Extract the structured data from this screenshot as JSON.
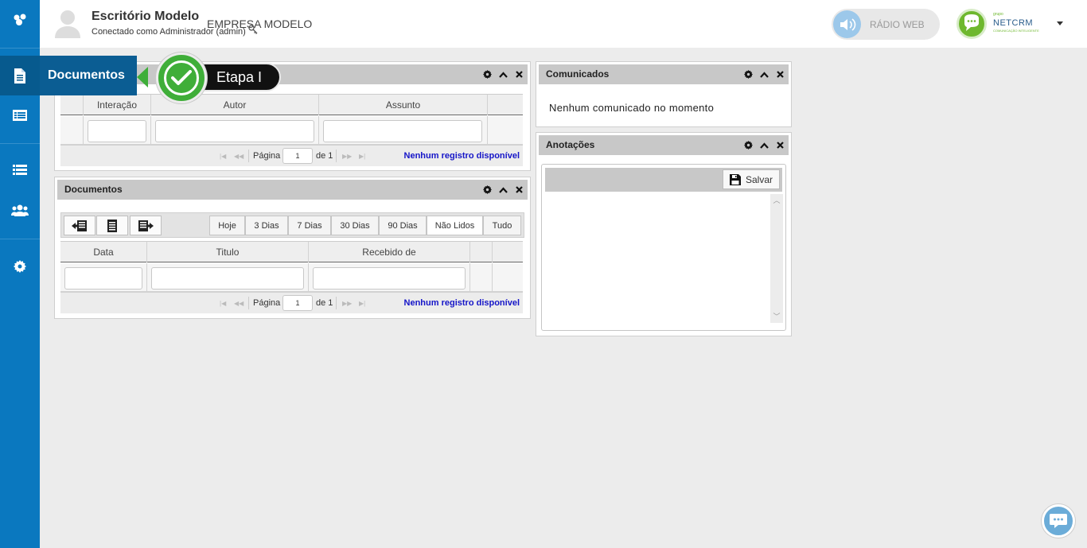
{
  "colors": {
    "sidebar": "#0a78bf",
    "accent_green": "#3fae39",
    "link_blue": "#1515c8"
  },
  "header": {
    "company": "Escritório Modelo",
    "connected_as": "Conectado como Administrador (admin)",
    "empresa": "EMPRESA MODELO",
    "radio_label": "RÁDIO WEB",
    "brand_small": "grupo",
    "brand_name": "NETCRM",
    "brand_sub": "COMUNICAÇÃO INTELIGENTE"
  },
  "sidebar": {
    "items": [
      {
        "icon": "logo-icon"
      },
      {
        "icon": "document-icon",
        "label": "Documentos"
      },
      {
        "icon": "list-card-icon"
      },
      {
        "icon": "list-icon"
      },
      {
        "icon": "users-icon"
      },
      {
        "icon": "gear-icon"
      }
    ]
  },
  "tour": {
    "step_label": "Etapa I"
  },
  "panel_interactions": {
    "columns": [
      "Interação",
      "Autor",
      "Assunto"
    ],
    "pager": {
      "page_label": "Página",
      "page_value": "1",
      "of_label": "de 1",
      "empty": "Nenhum registro disponível"
    }
  },
  "panel_documents": {
    "title": "Documentos",
    "filters": [
      "Hoje",
      "3 Dias",
      "7 Dias",
      "30 Dias",
      "90 Dias",
      "Não Lidos",
      "Tudo"
    ],
    "active_filter": "Não Lidos",
    "columns": [
      "Data",
      "Titulo",
      "Recebido de"
    ],
    "pager": {
      "page_label": "Página",
      "page_value": "1",
      "of_label": "de 1",
      "empty": "Nenhum registro disponível"
    }
  },
  "panel_comunicados": {
    "title": "Comunicados",
    "empty": "Nenhum comunicado no momento"
  },
  "panel_anotacoes": {
    "title": "Anotações",
    "save_label": "Salvar"
  }
}
